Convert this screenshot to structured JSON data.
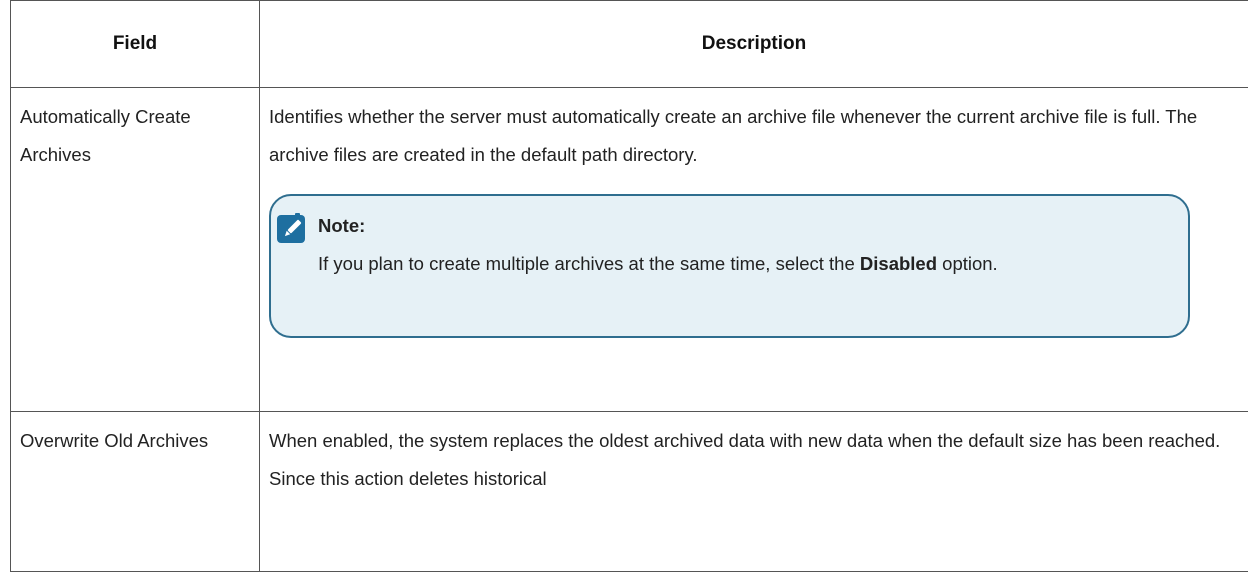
{
  "table": {
    "headers": {
      "field": "Field",
      "description": "Description"
    },
    "rows": [
      {
        "field": "Automatically Create Archives",
        "description": "Identifies whether the server must automatically create an archive file whenever the current archive file is full. The archive files are created in the default path directory.",
        "note": {
          "icon": "pencil-note-icon",
          "title": "Note:",
          "text_before": "If you plan to create multiple archives at the same time, select the",
          "bold": "Disabled",
          "text_after": " option."
        }
      },
      {
        "field": "Overwrite Old Archives",
        "description": "When enabled, the system replaces the oldest archived data with new data when the default size has been reached. Since this action deletes historical"
      }
    ]
  },
  "colors": {
    "border": "#555555",
    "note_background": "#e6f1f6",
    "note_border": "#2f6e8f",
    "icon": "#1e6fa0"
  }
}
